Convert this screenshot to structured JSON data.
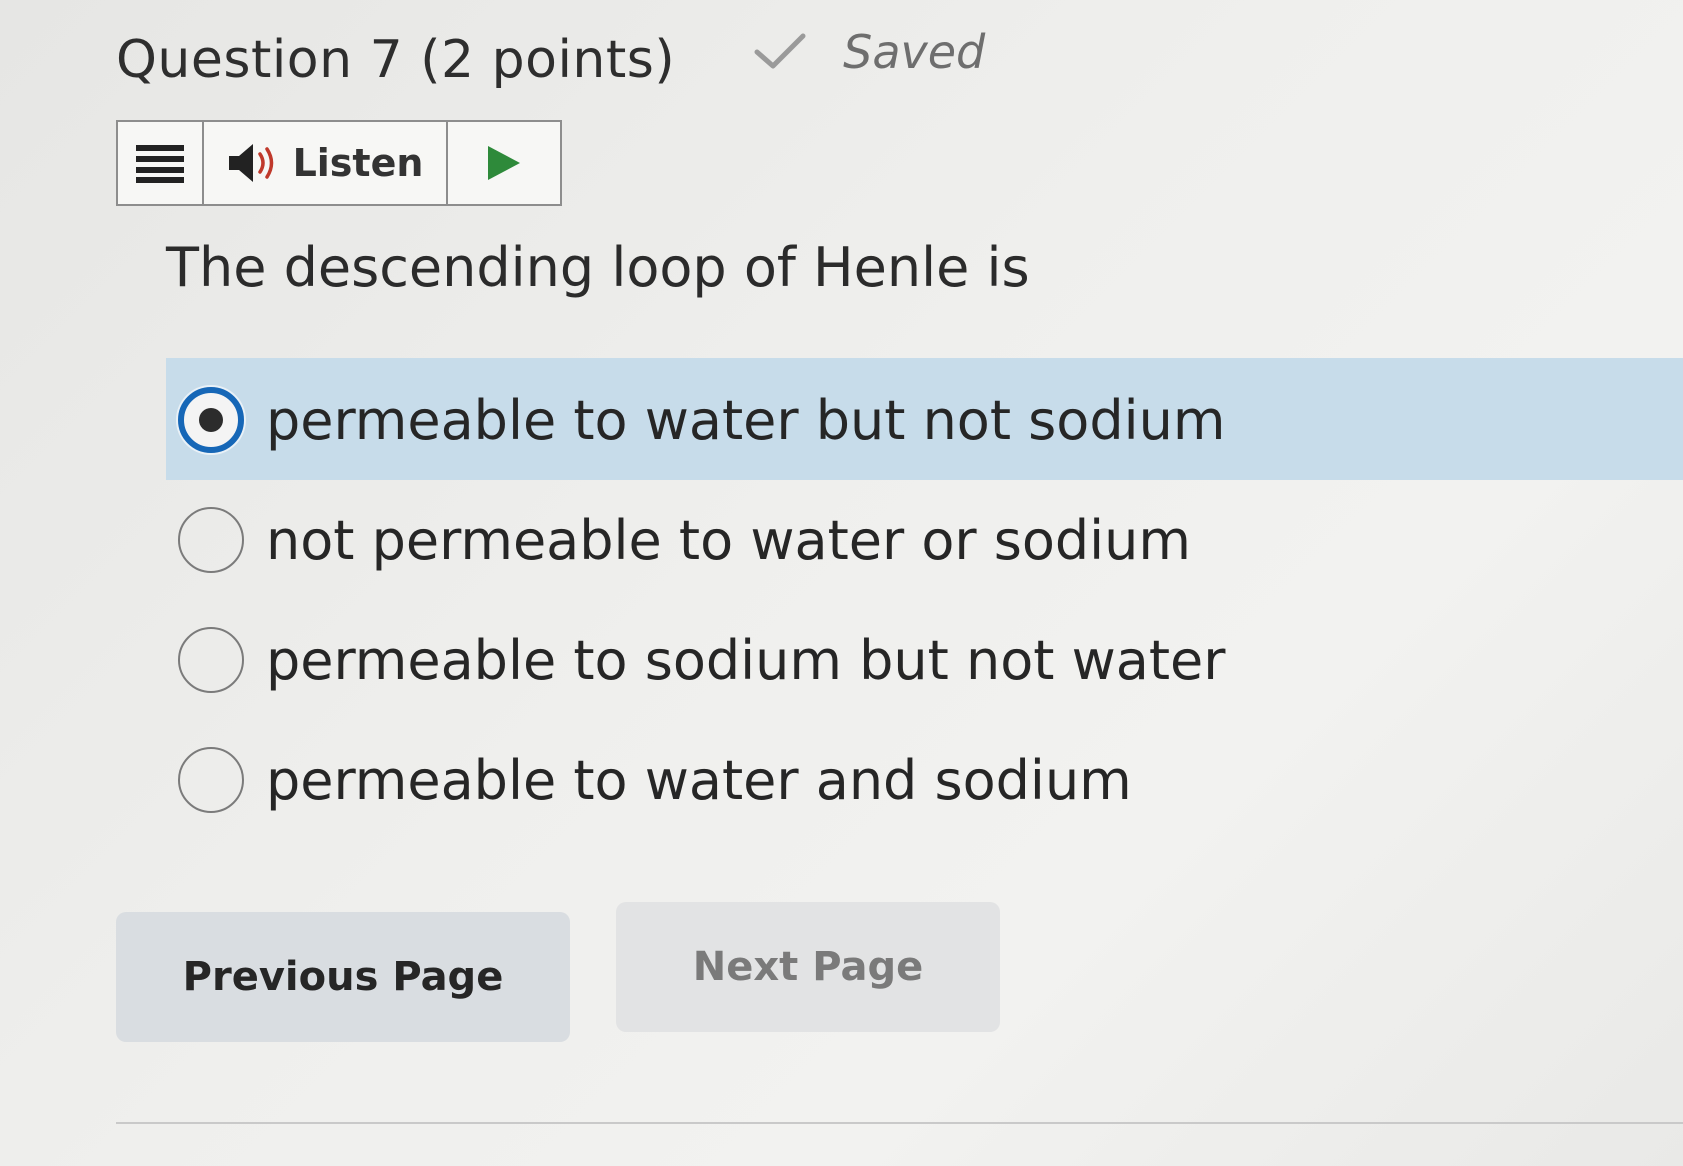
{
  "question": {
    "title": "Question 7 (2 points)",
    "saved_label": "Saved",
    "prompt": "The descending loop of Henle is"
  },
  "toolbar": {
    "menu_icon": "menu-icon",
    "speaker_icon": "speaker-icon",
    "listen_label": "Listen",
    "play_icon": "play-icon"
  },
  "options": [
    {
      "label": "permeable to water but not sodium",
      "selected": true
    },
    {
      "label": "not permeable to water or sodium",
      "selected": false
    },
    {
      "label": "permeable to sodium but not water",
      "selected": false
    },
    {
      "label": "permeable to water and sodium",
      "selected": false
    }
  ],
  "navigation": {
    "previous_label": "Previous Page",
    "next_label": "Next Page"
  },
  "colors": {
    "selected_background": "#c7dcea",
    "radio_accent": "#1667b7",
    "play_icon": "#2e8a3a"
  }
}
